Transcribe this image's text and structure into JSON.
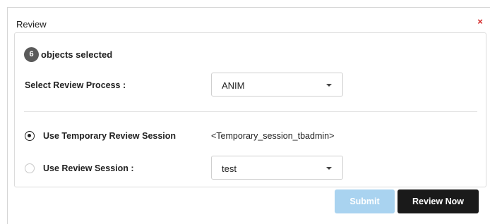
{
  "dialog": {
    "title": "Review",
    "close_glyph": "×"
  },
  "selection": {
    "count": "6",
    "label": "objects selected"
  },
  "review_process": {
    "label": "Select Review Process :",
    "selected": "ANIM"
  },
  "temporary_session": {
    "label": "Use Temporary Review Session",
    "checked": true,
    "session_name": "<Temporary_session_tbadmin>"
  },
  "review_session": {
    "label": "Use Review Session :",
    "checked": false,
    "selected": "test"
  },
  "actions": {
    "submit_label": "Submit",
    "review_now_label": "Review Now"
  },
  "colors": {
    "close": "#d21f1f",
    "submit_bg": "#a9d3f0",
    "review_now_bg": "#1a1a1a",
    "badge_bg": "#5a5a5a"
  }
}
